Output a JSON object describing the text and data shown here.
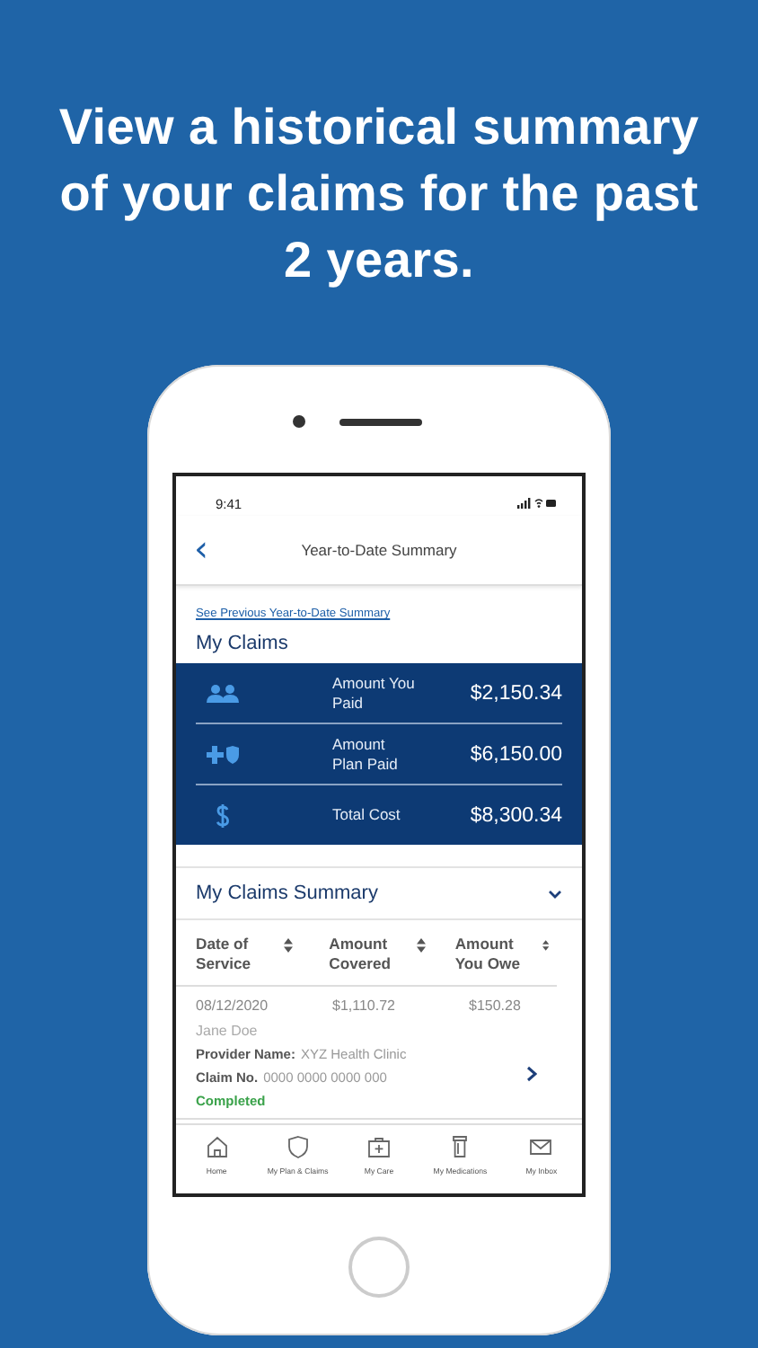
{
  "headline": "View a historical summary of your claims for the past 2 years.",
  "status_bar": {
    "time": "9:41"
  },
  "nav": {
    "back": "‹",
    "title": "Year-to-Date Summary"
  },
  "previous_link": "See Previous Year-to-Date Summary",
  "my_claims": {
    "title": "My Claims",
    "rows": [
      {
        "kind": "people",
        "label": "Amount You Paid",
        "value": "$2,150.34"
      },
      {
        "kind": "plan",
        "label": "Amount Plan Paid",
        "value": "$6,150.00"
      },
      {
        "kind": "dollar",
        "label": "Total Cost",
        "value": "$8,300.34"
      }
    ]
  },
  "summary": {
    "title": "My Claims Summary",
    "expanded": true,
    "columns": [
      "Date of Service",
      "Amount Covered",
      "Amount You Owe"
    ],
    "rows": [
      {
        "date": "08/12/2020",
        "covered": "$1,110.72",
        "owe": "$150.28",
        "patient": "Jane Doe",
        "provider_label": "Provider Name:",
        "provider": "XYZ Health Clinic",
        "claim_label": "Claim No.",
        "claim_no": "0000 0000 0000 000",
        "status": "Completed"
      }
    ]
  },
  "tab_bar": [
    {
      "kind": "home",
      "label": "Home"
    },
    {
      "kind": "shield",
      "label": "My Plan & Claims"
    },
    {
      "kind": "care",
      "label": "My Care"
    },
    {
      "kind": "meds",
      "label": "My Medications"
    },
    {
      "kind": "inbox",
      "label": "My Inbox"
    }
  ]
}
